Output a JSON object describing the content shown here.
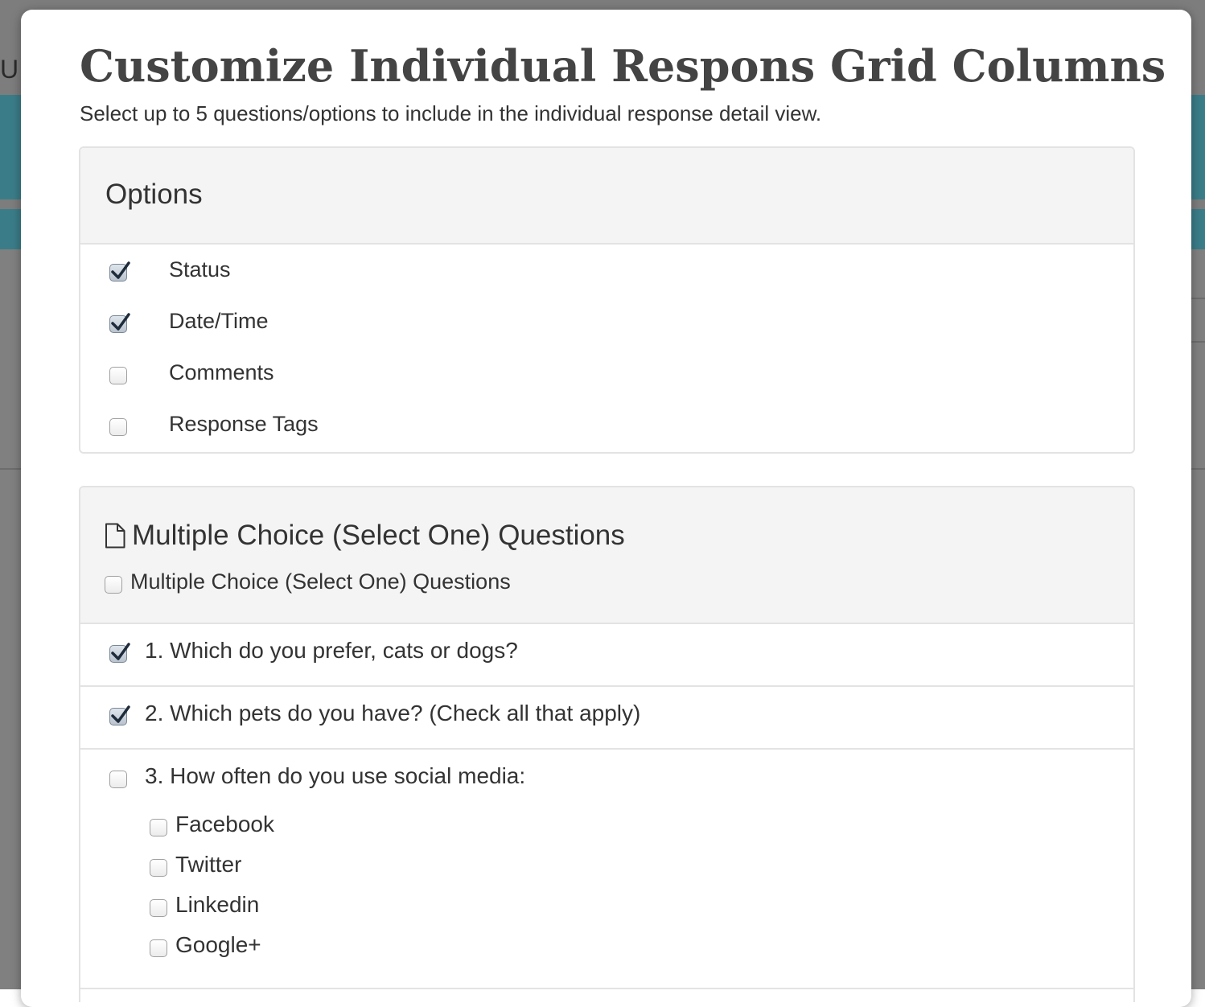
{
  "background": {
    "partial_text": "ULT"
  },
  "modal": {
    "title": "Customize Individual Respons Grid Columns",
    "subtitle": "Select up to 5 questions/options to include in the individual response detail view."
  },
  "options_panel": {
    "heading": "Options",
    "items": [
      {
        "label": "Status",
        "checked": true
      },
      {
        "label": "Date/Time",
        "checked": true
      },
      {
        "label": "Comments",
        "checked": false
      },
      {
        "label": "Response Tags",
        "checked": false
      }
    ]
  },
  "mc_panel": {
    "heading": "Multiple Choice (Select One) Questions",
    "icon": "document-icon",
    "select_all_label": "Multiple Choice (Select One) Questions",
    "select_all_checked": false,
    "questions": [
      {
        "label": "1. Which do you prefer, cats or dogs?",
        "checked": true
      },
      {
        "label": "2. Which pets do you have? (Check all that apply)",
        "checked": true
      },
      {
        "label": "3. How often do you use social media:",
        "checked": false,
        "sub_options": [
          {
            "label": "Facebook",
            "checked": false
          },
          {
            "label": "Twitter",
            "checked": false
          },
          {
            "label": "Linkedin",
            "checked": false
          },
          {
            "label": "Google+",
            "checked": false
          }
        ]
      }
    ]
  },
  "colors": {
    "backdrop": "#7d7d7d",
    "teal_band": "#3a7d88",
    "panel_header_bg": "#f4f4f4",
    "panel_border": "#e3e3e3",
    "title_text": "#444444",
    "body_text": "#333333",
    "checkmark": "#1d2b3a"
  }
}
